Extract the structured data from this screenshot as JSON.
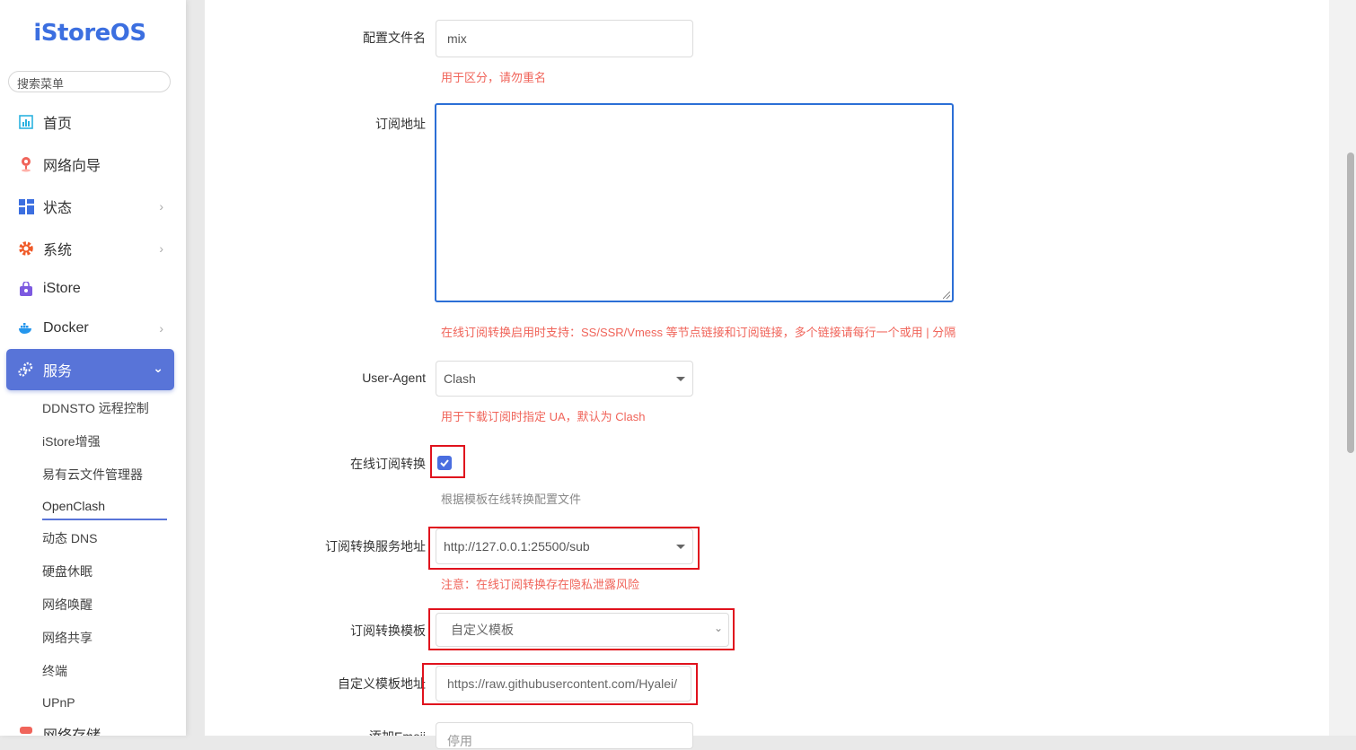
{
  "brand": {
    "logo": "iStoreOS"
  },
  "sidebar": {
    "search_placeholder": "搜索菜单",
    "items": [
      {
        "label": "首页",
        "icon": "dashboard-icon"
      },
      {
        "label": "网络向导",
        "icon": "location-pin-icon"
      },
      {
        "label": "状态",
        "icon": "grid-icon",
        "has_children": true
      },
      {
        "label": "系统",
        "icon": "gear-icon",
        "has_children": true
      },
      {
        "label": "iStore",
        "icon": "store-bag-icon"
      },
      {
        "label": "Docker",
        "icon": "docker-whale-icon",
        "has_children": true
      },
      {
        "label": "服务",
        "icon": "services-gears-icon",
        "has_children": true,
        "active": true
      },
      {
        "label": "网络存储",
        "icon": "storage-icon",
        "has_children": true
      }
    ],
    "sub_items": [
      "DDNSTO 远程控制",
      "iStore增强",
      "易有云文件管理器",
      "OpenClash",
      "动态 DNS",
      "硬盘休眠",
      "网络唤醒",
      "网络共享",
      "终端",
      "UPnP"
    ],
    "active_sub": "OpenClash"
  },
  "form": {
    "config_name": {
      "label": "配置文件名",
      "value": "mix",
      "hint": "用于区分，请勿重名"
    },
    "subscribe_url": {
      "label": "订阅地址",
      "value": "",
      "hint": "在线订阅转换启用时支持：SS/SSR/Vmess 等节点链接和订阅链接，多个链接请每行一个或用 | 分隔"
    },
    "user_agent": {
      "label": "User-Agent",
      "value": "Clash",
      "hint": "用于下载订阅时指定 UA，默认为 Clash"
    },
    "online_convert": {
      "label": "在线订阅转换",
      "checked": true,
      "hint": "根据模板在线转换配置文件"
    },
    "convert_server": {
      "label": "订阅转换服务地址",
      "value": "http://127.0.0.1:25500/sub",
      "hint": "注意：在线订阅转换存在隐私泄露风险"
    },
    "convert_template": {
      "label": "订阅转换模板",
      "value": "自定义模板"
    },
    "custom_template_url": {
      "label": "自定义模板地址",
      "value": "https://raw.githubusercontent.com/Hyalei/"
    },
    "emoji": {
      "label": "添加Emoji",
      "value": "停用"
    }
  },
  "colors": {
    "accent": "#5874d8",
    "hint_red": "#f0645a",
    "highlight_box": "#e0121d",
    "focus_blue": "#2c6fd6"
  }
}
